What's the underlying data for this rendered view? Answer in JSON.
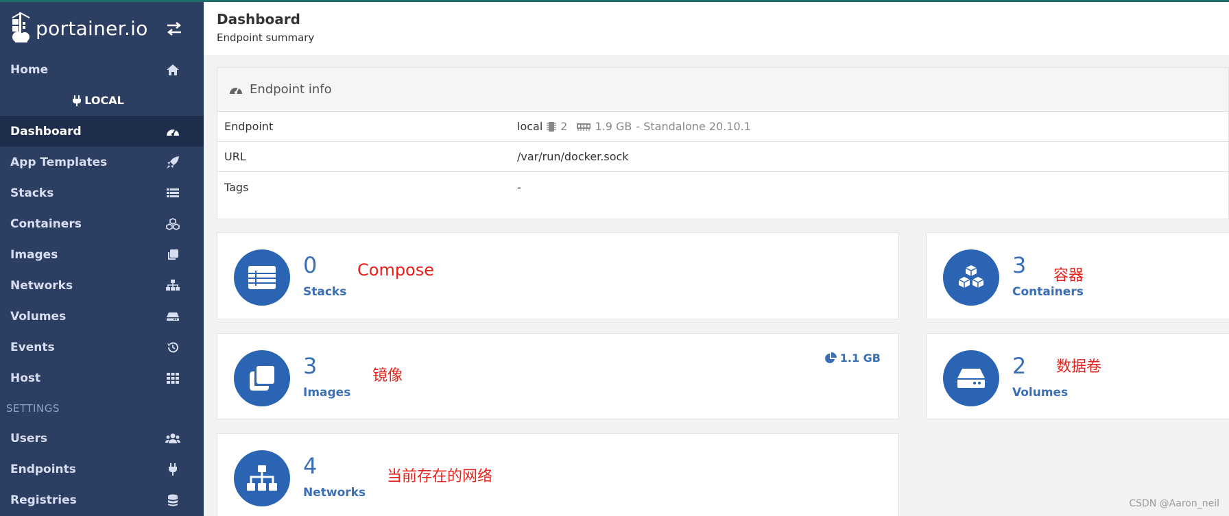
{
  "app": {
    "brand": "portainer.io",
    "accent": "#2a64b3",
    "sidebar_bg": "#2d3e63"
  },
  "sidebar": {
    "home": {
      "label": "Home",
      "icon": "home-icon"
    },
    "endpoint_name": "LOCAL",
    "items": [
      {
        "label": "Dashboard",
        "icon": "dashboard-icon",
        "active": true
      },
      {
        "label": "App Templates",
        "icon": "rocket-icon"
      },
      {
        "label": "Stacks",
        "icon": "list-icon"
      },
      {
        "label": "Containers",
        "icon": "cubes-icon"
      },
      {
        "label": "Images",
        "icon": "clone-icon"
      },
      {
        "label": "Networks",
        "icon": "sitemap-icon"
      },
      {
        "label": "Volumes",
        "icon": "hdd-icon"
      },
      {
        "label": "Events",
        "icon": "history-icon"
      },
      {
        "label": "Host",
        "icon": "th-icon"
      }
    ],
    "settings_title": "SETTINGS",
    "settings_items": [
      {
        "label": "Users",
        "icon": "users-icon"
      },
      {
        "label": "Endpoints",
        "icon": "plug-icon"
      },
      {
        "label": "Registries",
        "icon": "database-icon"
      }
    ]
  },
  "header": {
    "title": "Dashboard",
    "subtitle": "Endpoint summary"
  },
  "endpoint_info": {
    "title": "Endpoint info",
    "rows": [
      {
        "key": "Endpoint",
        "name": "local",
        "cpu": "2",
        "memory": "1.9 GB",
        "mode": "- Standalone 20.10.1"
      },
      {
        "key": "URL",
        "value": "/var/run/docker.sock"
      },
      {
        "key": "Tags",
        "value": "-"
      }
    ]
  },
  "cards": {
    "stacks": {
      "count": "0",
      "label": "Stacks",
      "note": "Compose"
    },
    "containers": {
      "count": "3",
      "label": "Containers",
      "note": "容器"
    },
    "images": {
      "count": "3",
      "label": "Images",
      "note": "镜像",
      "size": "1.1 GB"
    },
    "volumes": {
      "count": "2",
      "label": "Volumes",
      "note": "数据卷"
    },
    "networks": {
      "count": "4",
      "label": "Networks",
      "note": "当前存在的网络"
    }
  },
  "watermark": "CSDN @Aaron_neil"
}
